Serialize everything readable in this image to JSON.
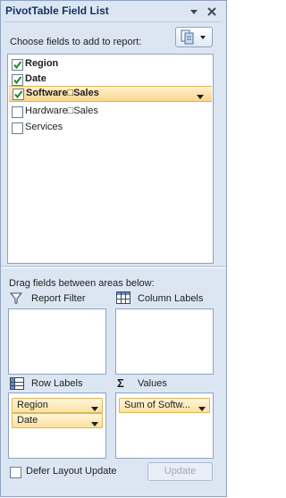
{
  "title": "PivotTable Field List",
  "choose_label": "Choose fields to add to report:",
  "fields": [
    {
      "label": "Region",
      "checked": true,
      "bold": true,
      "selected": false
    },
    {
      "label": "Date",
      "checked": true,
      "bold": true,
      "selected": false
    },
    {
      "label": "Software□Sales",
      "checked": true,
      "bold": true,
      "selected": true
    },
    {
      "label": "Hardware□Sales",
      "checked": false,
      "bold": false,
      "selected": false
    },
    {
      "label": "Services",
      "checked": false,
      "bold": false,
      "selected": false
    }
  ],
  "drag_label": "Drag fields between areas below:",
  "areas": {
    "report_filter": {
      "label": "Report Filter",
      "icon": "filter-icon"
    },
    "column_labels": {
      "label": "Column Labels",
      "icon": "column-labels-icon"
    },
    "row_labels": {
      "label": "Row Labels",
      "icon": "row-labels-icon",
      "items": [
        "Region",
        "Date"
      ]
    },
    "values": {
      "label": "Values",
      "icon": "sigma-icon",
      "items": [
        "Sum of Softw..."
      ]
    }
  },
  "defer_label": "Defer Layout Update",
  "defer_checked": false,
  "update_label": "Update",
  "colors": {
    "panel_bg": "#dce6f3",
    "border": "#8ea3c0",
    "title_text": "#15325e",
    "selection": "#fcd48a",
    "chip": "#fbe1a0",
    "check": "#1f8a1f"
  }
}
